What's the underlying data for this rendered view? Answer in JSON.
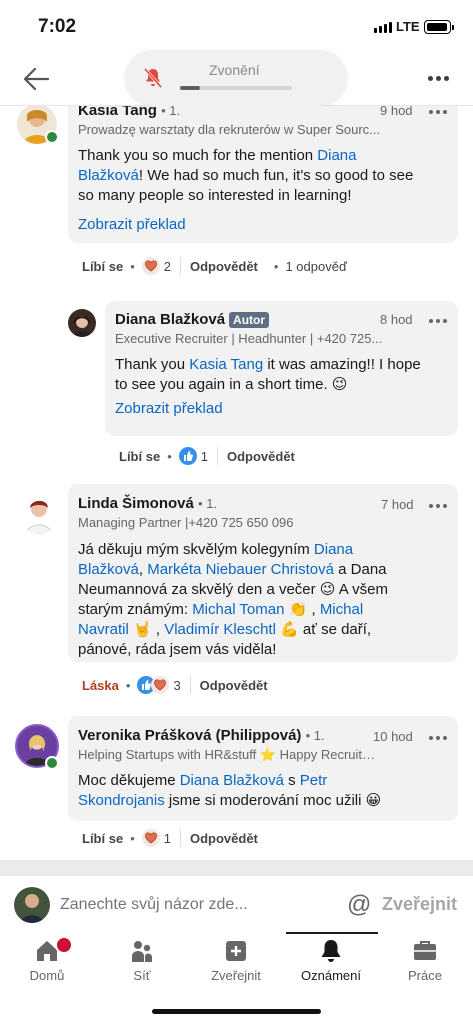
{
  "status_bar": {
    "time": "7:02",
    "network": "LTE"
  },
  "call_banner": {
    "title": "Zvonění",
    "progress": 0.18
  },
  "comments": [
    {
      "author": "Kasia Tang",
      "degree": "• 1.",
      "headline": "Prowadzę warsztaty dla rekruterów w Super Sourc...",
      "time": "9 hod",
      "text_parts": [
        {
          "t": "Thank you so much for the mention ",
          "link": false
        },
        {
          "t": "Diana Blažková",
          "link": true
        },
        {
          "t": "! We had so much fun, it's so good to see so many people so interested in learning!",
          "link": false
        }
      ],
      "translate": "Zobrazit překlad",
      "like_label": "Líbí se",
      "reaction_count": "2",
      "reply_label": "Odpovědět",
      "replies_label": "1 odpověď"
    },
    {
      "author": "Diana Blažková",
      "badge": "Autor",
      "headline": "Executive Recruiter | Headhunter | +420 725...",
      "time": "8 hod",
      "text_parts": [
        {
          "t": "Thank you ",
          "link": false
        },
        {
          "t": "Kasia Tang",
          "link": true
        },
        {
          "t": " it was amazing!! I hope to see you again in a short time. 😉",
          "link": false
        }
      ],
      "translate": "Zobrazit překlad",
      "like_label": "Líbí se",
      "reaction_count": "1",
      "reply_label": "Odpovědět"
    },
    {
      "author": "Linda Šimonová",
      "degree": "• 1.",
      "headline": "Managing Partner |+420 725 650 096",
      "time": "7 hod",
      "text_parts": [
        {
          "t": "Já děkuju mým skvělým kolegyním ",
          "link": false
        },
        {
          "t": "Diana Blažková",
          "link": true
        },
        {
          "t": ", ",
          "link": false
        },
        {
          "t": "Markéta Niebauer Christová",
          "link": true
        },
        {
          "t": " a Dana Neumannová za skvělý den a večer 😉 A všem starým známým:  ",
          "link": false
        },
        {
          "t": "Michal Toman",
          "link": true
        },
        {
          "t": " 👏 , ",
          "link": false
        },
        {
          "t": "Michal Navratil",
          "link": true
        },
        {
          "t": " 🤘 , ",
          "link": false
        },
        {
          "t": "Vladimír Kleschtl",
          "link": true
        },
        {
          "t": " 💪  ať se daří, pánové, ráda jsem vás viděla!",
          "link": false
        }
      ],
      "like_label": "Láska",
      "reaction_count": "3",
      "reply_label": "Odpovědět"
    },
    {
      "author": "Veronika Prášková (Philippová)",
      "degree": "• 1.",
      "headline": "Helping Startups with HR&stuff ⭐ Happy Recruite...",
      "time": "10 hod",
      "text_parts": [
        {
          "t": "Moc děkujeme ",
          "link": false
        },
        {
          "t": "Diana Blažková",
          "link": true
        },
        {
          "t": " s ",
          "link": false
        },
        {
          "t": "Petr Skondrojanis",
          "link": true
        },
        {
          "t": " jsme si moderování moc užili 😀",
          "link": false
        }
      ],
      "like_label": "Líbí se",
      "reaction_count": "1",
      "reply_label": "Odpovědět"
    }
  ],
  "composer": {
    "placeholder": "Zanechte svůj názor zde...",
    "at": "@",
    "publish": "Zveřejnit"
  },
  "tabs": [
    {
      "label": "Domů",
      "icon": "home-icon"
    },
    {
      "label": "Síť",
      "icon": "network-icon"
    },
    {
      "label": "Zveřejnit",
      "icon": "plus-square-icon"
    },
    {
      "label": "Oznámení",
      "icon": "bell-icon",
      "active": true
    },
    {
      "label": "Práce",
      "icon": "briefcase-icon"
    }
  ],
  "colors": {
    "link": "#0a66c2",
    "bubble": "#f2f2f2",
    "love": "#b24020",
    "badge": "#cb112d"
  }
}
